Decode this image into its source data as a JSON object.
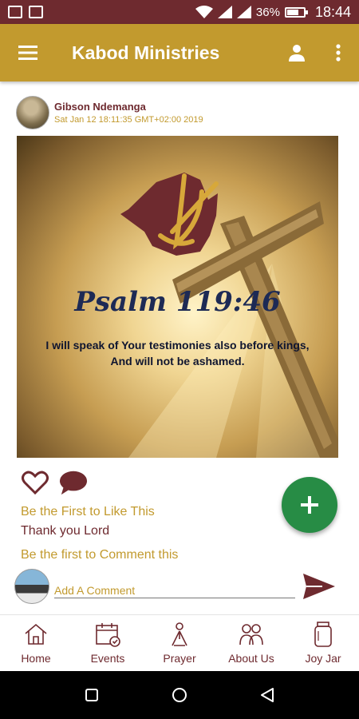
{
  "status_bar": {
    "battery_pct": "36%",
    "time": "18:44",
    "icons": [
      "image-icon",
      "activity-icon",
      "wifi-icon",
      "signal-icon",
      "signal-icon",
      "battery-icon"
    ]
  },
  "app_bar": {
    "title": "Kabod Ministries",
    "icons": [
      "menu-icon",
      "profile-icon",
      "more-icon"
    ]
  },
  "post": {
    "author": "Gibson Ndemanga",
    "date": "Sat Jan 12 18:11:35 GMT+02:00 2019",
    "image": {
      "heading": "Psalm 119:46",
      "verse_line_1": "I will speak of Your testimonies also before kings,",
      "verse_line_2": "And will not be ashamed."
    },
    "likes_text": "Be the First to Like This",
    "caption": "Thank you Lord",
    "comments_text": "Be the first to Comment this",
    "comment_placeholder": "Add A Comment"
  },
  "bottom_nav": {
    "items": [
      {
        "label": "Home",
        "icon": "home-icon"
      },
      {
        "label": "Events",
        "icon": "calendar-icon"
      },
      {
        "label": "Prayer",
        "icon": "prayer-icon"
      },
      {
        "label": "About Us",
        "icon": "people-icon"
      },
      {
        "label": "Joy Jar",
        "icon": "jar-icon"
      }
    ]
  },
  "colors": {
    "status_bar": "#6e2a2f",
    "app_bar": "#c29a2e",
    "maroon": "#6e2a2f",
    "gold": "#c29a2e",
    "fab": "#278c45"
  }
}
